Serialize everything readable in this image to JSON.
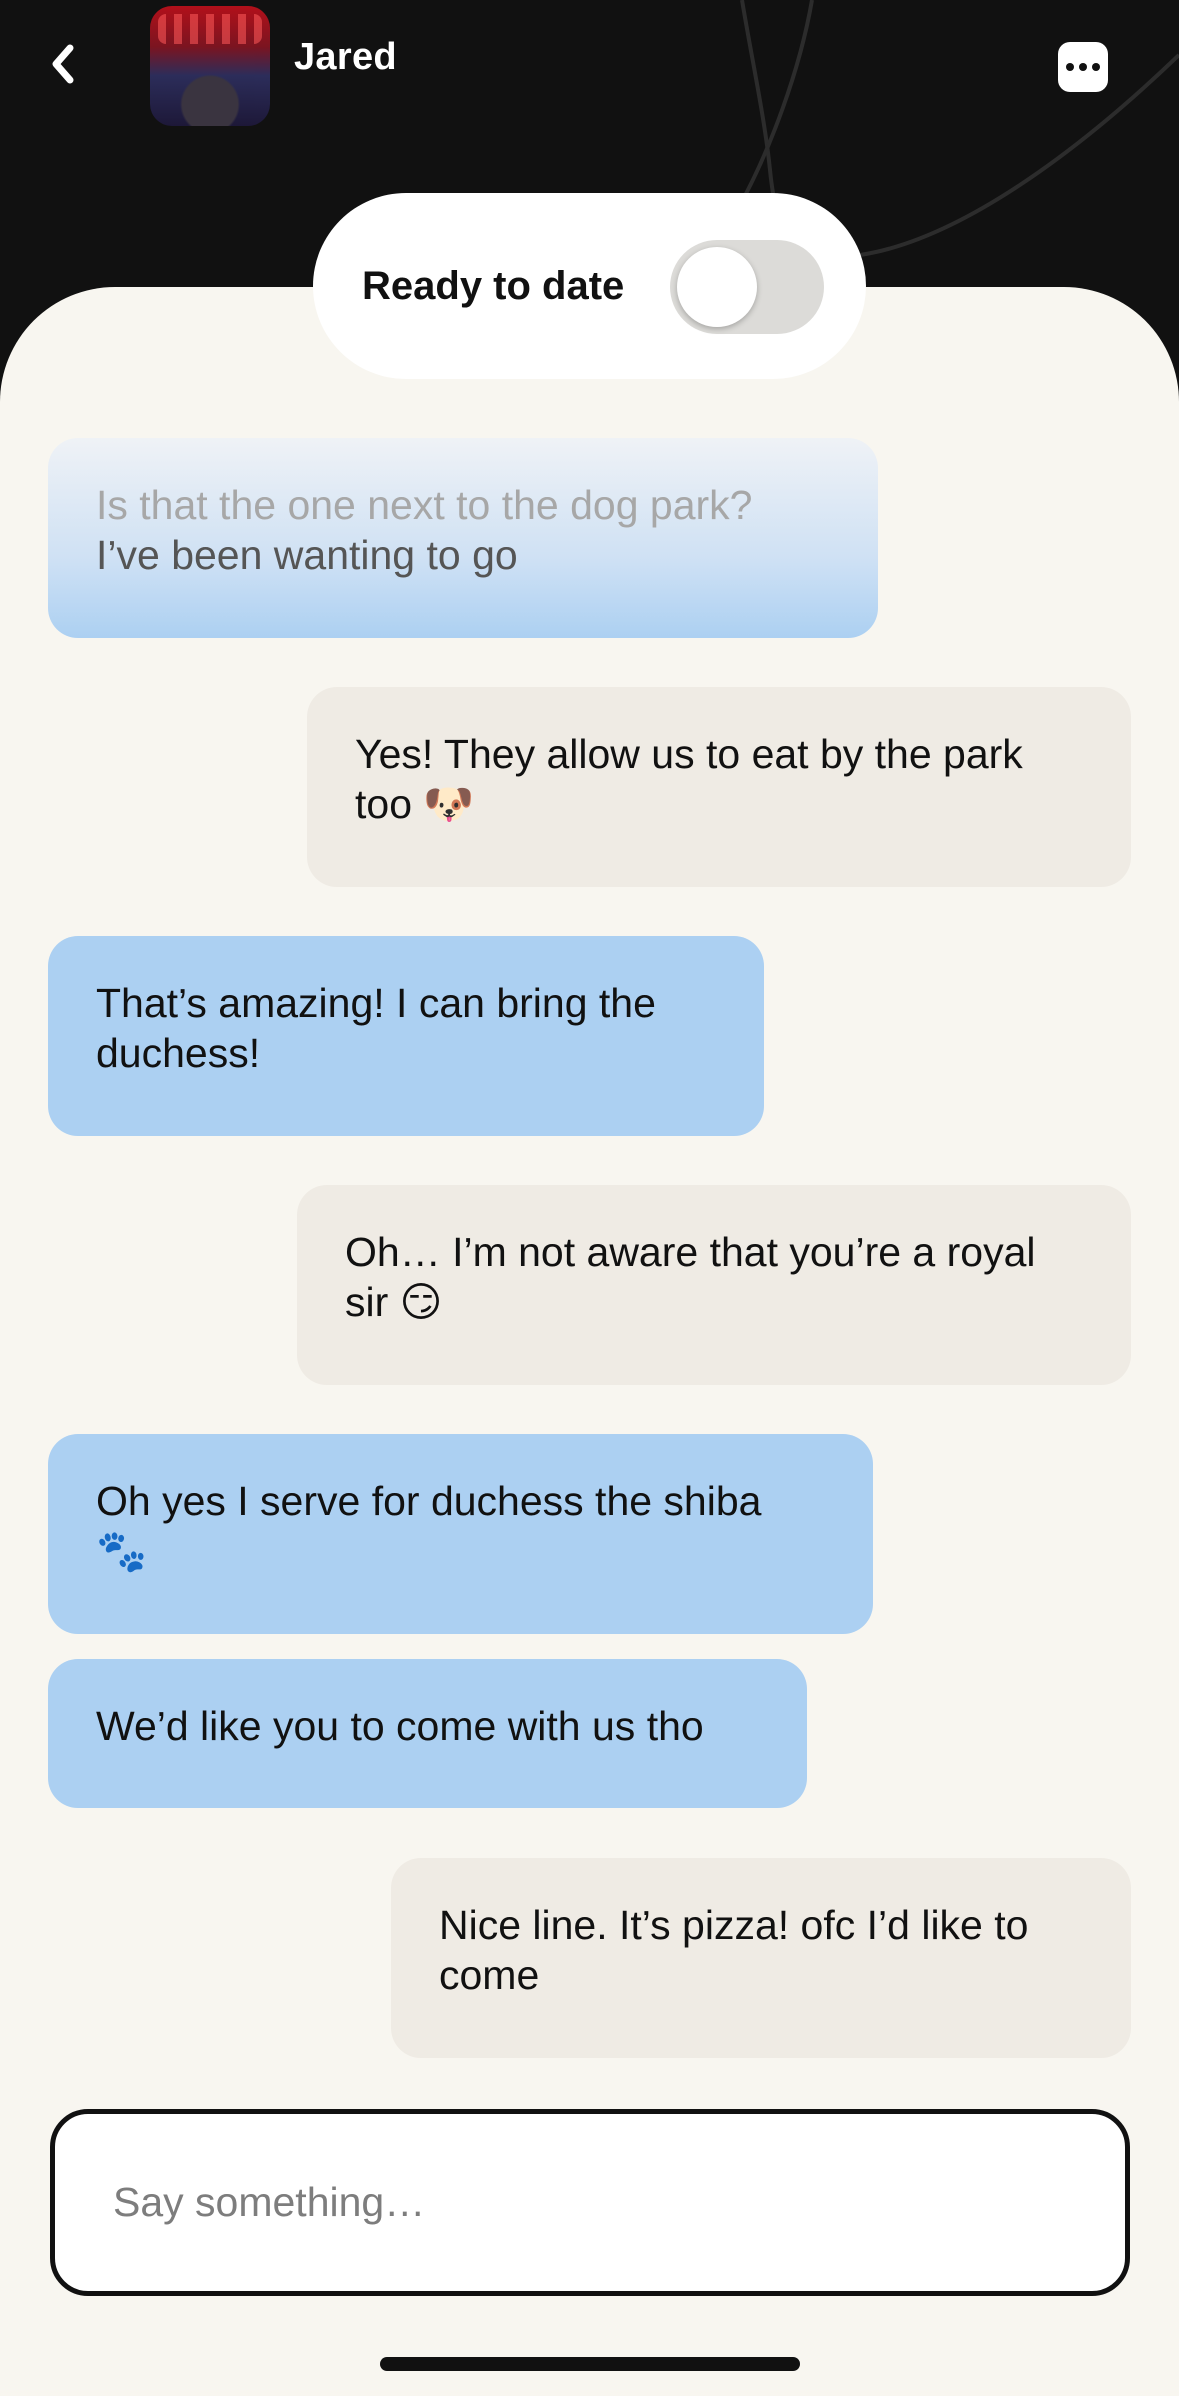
{
  "header": {
    "back_icon": "chevron-left-icon",
    "contact_name": "Jared",
    "avatar": "profile photo",
    "more_icon": "ellipsis-icon"
  },
  "status": {
    "label": "Ready to date",
    "toggle_on": false
  },
  "messages": [
    {
      "side": "received",
      "lines": [
        "Is that the one next to the dog park?",
        "I’ve been wanting to go"
      ]
    },
    {
      "side": "sent",
      "lines": [
        "Yes! They allow us to eat by the park",
        "too 🐶"
      ]
    },
    {
      "side": "received",
      "lines": [
        "That’s amazing! I can bring the",
        "duchess!"
      ]
    },
    {
      "side": "sent",
      "lines": [
        "Oh… I’m not aware that you’re a royal",
        "sir 😏"
      ]
    },
    {
      "side": "received",
      "lines": [
        "Oh yes I serve for duchess the shiba",
        "🐾"
      ]
    },
    {
      "side": "received",
      "lines": [
        "We’d like you to come with us tho"
      ]
    },
    {
      "side": "sent",
      "lines": [
        "Nice line. It’s pizza! ofc I’d like to",
        "come"
      ]
    }
  ],
  "composer": {
    "placeholder": "Say something…"
  },
  "colors": {
    "background_dark": "#111111",
    "chat_background": "#f8f6f0",
    "received_bubble": "#acd0f2",
    "sent_bubble": "#efebe4",
    "toggle_track": "#dcdbd8"
  }
}
